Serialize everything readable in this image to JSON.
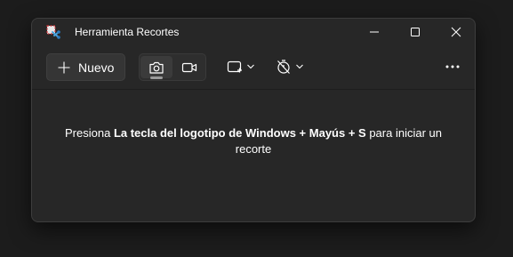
{
  "window": {
    "title": "Herramienta Recortes",
    "icon": "snipping-tool-icon"
  },
  "toolbar": {
    "new_label": "Nuevo",
    "modes": [
      "camera-icon",
      "video-camera-icon"
    ],
    "selected_mode": "camera-icon",
    "shape_icon": "rectangle-snip-icon",
    "delay_icon": "timer-off-icon",
    "more_icon": "more-icon"
  },
  "message": {
    "prefix": "Presiona ",
    "shortcut": "La tecla del logotipo de Windows + Mayús + S",
    "suffix": " para iniciar un",
    "line2": "recorte"
  },
  "colors": {
    "background": "#1c1c1c",
    "window": "#272727",
    "text": "#ffffff"
  }
}
